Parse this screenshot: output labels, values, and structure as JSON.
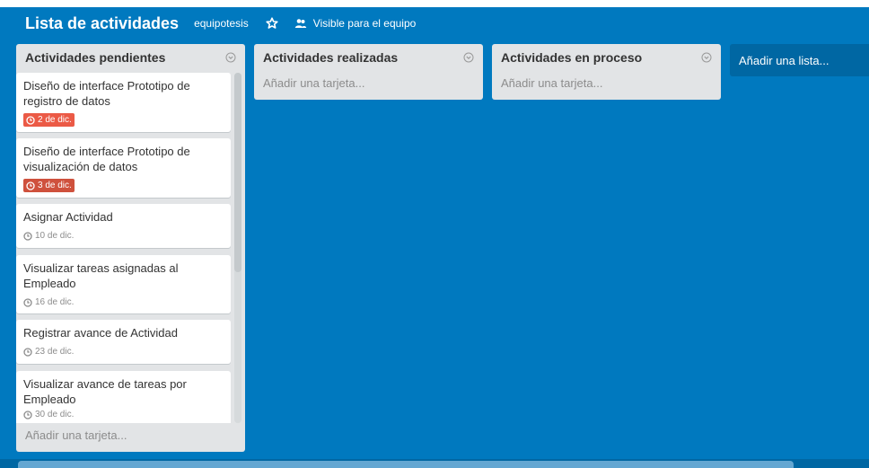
{
  "header": {
    "board_title": "Lista de actividades",
    "team": "equipotesis",
    "visibility": "Visible para el equipo",
    "star_icon": "star-icon",
    "visibility_icon": "team-icon"
  },
  "lists": [
    {
      "title": "Actividades pendientes",
      "add_card": "Añadir una tarjeta...",
      "cards": [
        {
          "title": "Diseño de interface Prototipo de registro de datos",
          "due": "2 de dic."
        },
        {
          "title": "Diseño de interface Prototipo de visualización de datos",
          "due": "3 de dic."
        },
        {
          "title": "Asignar Actividad",
          "due": "10 de dic."
        },
        {
          "title": "Visualizar tareas asignadas al Empleado",
          "due": "16 de dic."
        },
        {
          "title": "Registrar avance de Actividad",
          "due": "23 de dic."
        },
        {
          "title": "Visualizar avance de tareas por Empleado",
          "due": "30 de dic."
        }
      ]
    },
    {
      "title": "Actividades realizadas",
      "add_card": "Añadir una tarjeta..."
    },
    {
      "title": "Actividades en proceso",
      "add_card": "Añadir una tarjeta..."
    }
  ],
  "add_list": "Añadir una lista...",
  "colors": {
    "board_bg": "#0079bf",
    "due_soon": "#ec9488",
    "due_overdue": "#cf513d"
  }
}
